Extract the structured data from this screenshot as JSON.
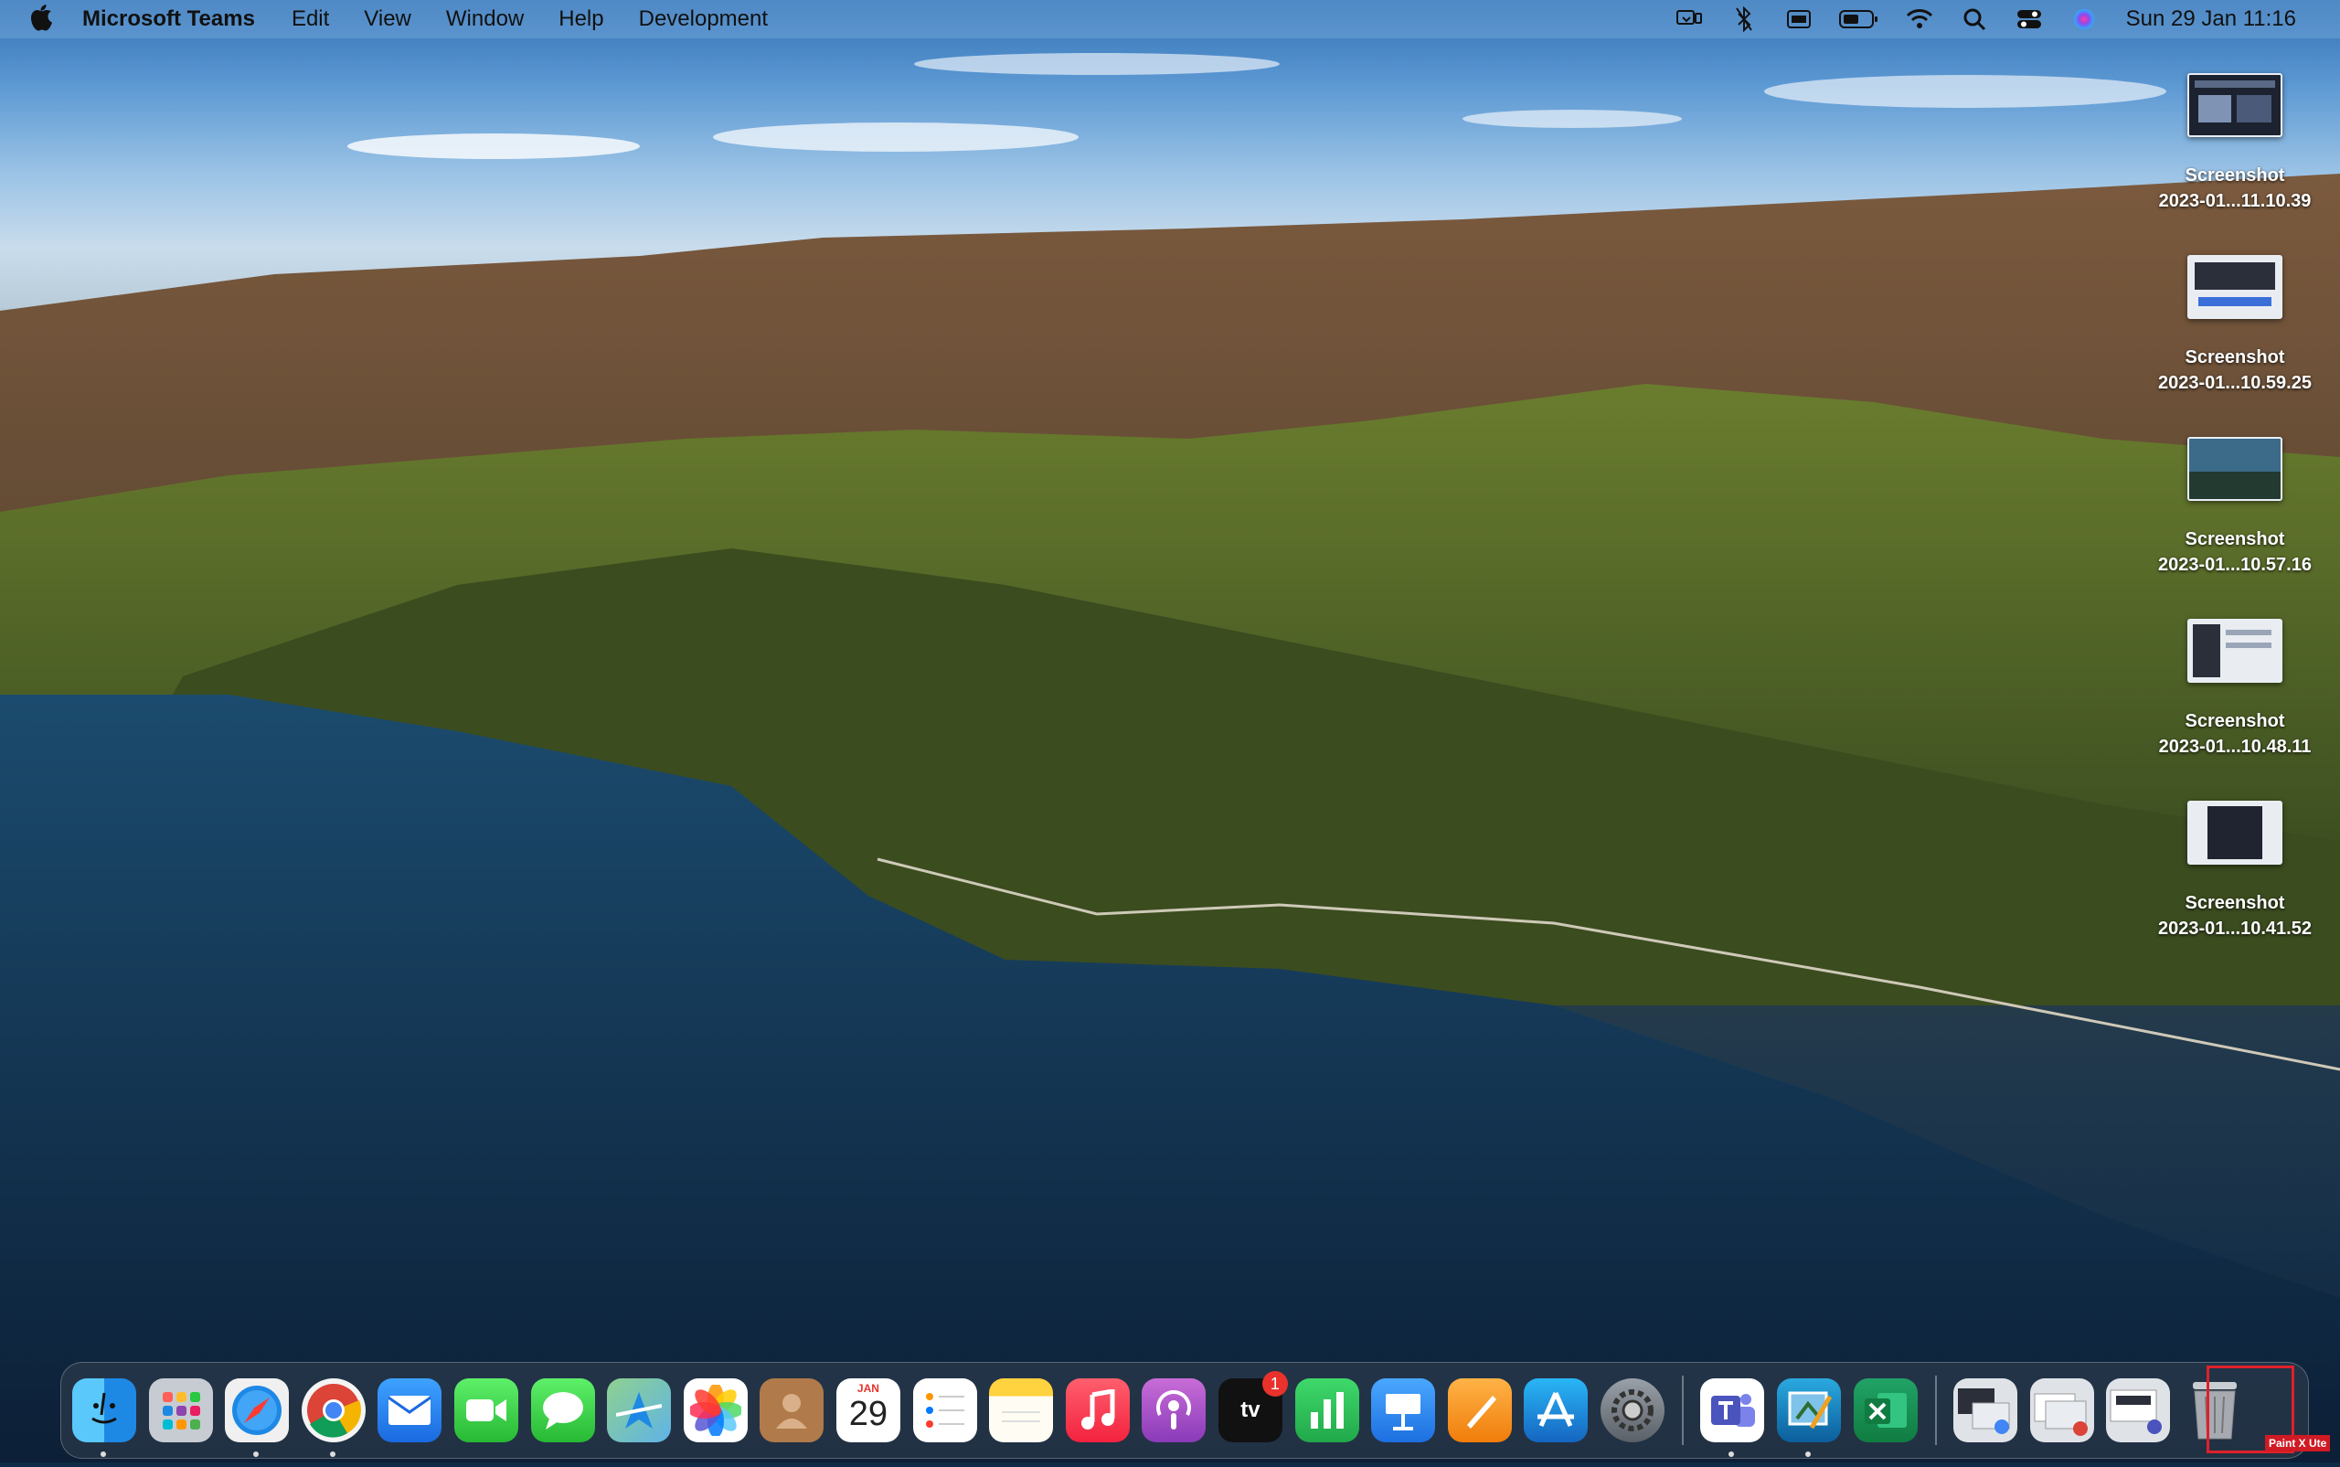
{
  "menubar": {
    "app_name": "Microsoft Teams",
    "items": [
      "Edit",
      "View",
      "Window",
      "Help",
      "Development"
    ],
    "clock": "Sun 29 Jan  11:16"
  },
  "desktop_files": [
    {
      "name": "Screenshot",
      "sub": "2023-01...11.10.39"
    },
    {
      "name": "Screenshot",
      "sub": "2023-01...10.59.25"
    },
    {
      "name": "Screenshot",
      "sub": "2023-01...10.57.16"
    },
    {
      "name": "Screenshot",
      "sub": "2023-01...10.48.11"
    },
    {
      "name": "Screenshot",
      "sub": "2023-01...10.41.52"
    }
  ],
  "dock": {
    "calendar_month": "JAN",
    "calendar_day": "29",
    "tv_badge": "1",
    "tv_label": "tv"
  },
  "watermark": "Paint X Ute"
}
